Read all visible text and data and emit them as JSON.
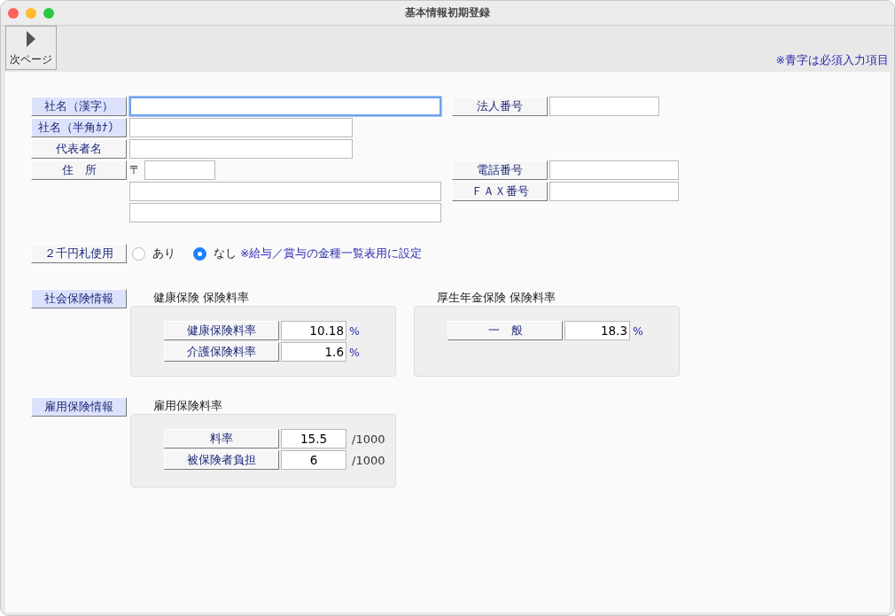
{
  "window": {
    "title": "基本情報初期登録"
  },
  "toolbar": {
    "next_button": {
      "label": "次ページ"
    },
    "note": "※青字は必須入力項目"
  },
  "company_fields": [
    {
      "label": "社名（漢字）",
      "required": true,
      "focused": true
    },
    {
      "label": "社名（半角ｶﾅ）",
      "required": true,
      "focused": false
    },
    {
      "label": "代表者名",
      "required": false,
      "focused": false
    }
  ],
  "address": {
    "label": "住　所",
    "required": false,
    "postal_mark": "〒"
  },
  "right_groups": [
    [
      {
        "label": "法人番号",
        "required": false
      }
    ],
    [
      {
        "label": "電話番号",
        "required": false
      },
      {
        "label": "ＦＡＸ番号",
        "required": false
      }
    ]
  ],
  "two_thousand_yen": {
    "label": "２千円札使用",
    "required": false,
    "options": [
      {
        "label": "あり",
        "selected": false
      },
      {
        "label": "なし",
        "selected": true
      }
    ],
    "note": "※給与／賞与の金種一覧表用に設定"
  },
  "sections": [
    {
      "label": "社会保険情報",
      "required": true,
      "panels": [
        {
          "title": "健康保険 保険料率",
          "kind": "percent",
          "rows": [
            {
              "label": "健康保険料率",
              "value": "10.18",
              "unit": "%"
            },
            {
              "label": "介護保険料率",
              "value": "1.6",
              "unit": "%"
            }
          ]
        },
        {
          "title": "厚生年金保険 保険料率",
          "kind": "percent",
          "rows": [
            {
              "label": "一　般",
              "value": "18.3",
              "unit": "%"
            }
          ]
        }
      ]
    },
    {
      "label": "雇用保険情報",
      "required": true,
      "panels": [
        {
          "title": "雇用保険料率",
          "kind": "per_mille",
          "rows": [
            {
              "label": "料率",
              "value": "15.5",
              "unit": "/1000"
            },
            {
              "label": "被保険者負担",
              "value": "6",
              "unit": "/1000"
            }
          ]
        }
      ]
    }
  ]
}
